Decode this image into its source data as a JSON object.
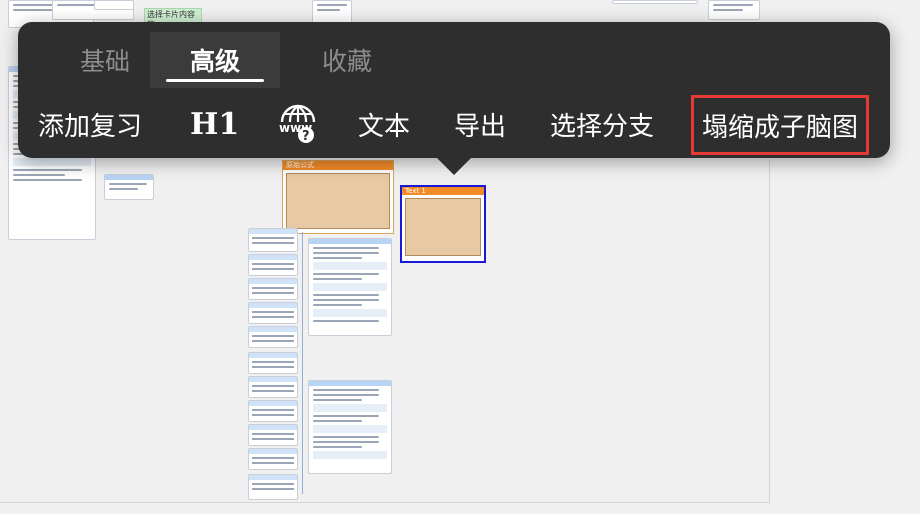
{
  "tabs": [
    {
      "label": "基础",
      "active": false
    },
    {
      "label": "高级",
      "active": true
    },
    {
      "label": "收藏",
      "active": false
    }
  ],
  "actions": {
    "add_review": "添加复习",
    "heading": "H1",
    "web_icon": "www-question-icon",
    "text": "文本",
    "export": "导出",
    "select_branch": "选择分支",
    "collapse_submap": "塌缩成子脑图"
  },
  "canvas": {
    "green_note": "选择卡片内容的",
    "orange_card_title": "原始公式",
    "selected_card_title": "Text 1"
  },
  "colors": {
    "toolbar_bg": "#2e2e2e",
    "highlight": "#e53935",
    "selection": "#1a18d8",
    "orange": "#f28c28"
  }
}
